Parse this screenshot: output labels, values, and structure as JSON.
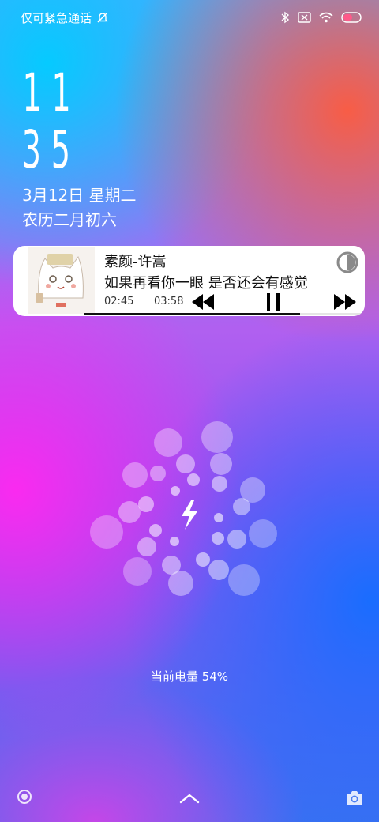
{
  "status_bar": {
    "carrier_text": "仅可紧急通话",
    "icons": [
      "bell-off-icon",
      "bluetooth-icon",
      "no-sim-icon",
      "wifi-icon",
      "battery-icon"
    ]
  },
  "clock": {
    "hours": "11",
    "minutes": "35"
  },
  "date": {
    "solar": "3月12日 星期二",
    "lunar": "农历二月初六"
  },
  "music": {
    "title": "素颜-许嵩",
    "lyric": "如果再看你一眼 是否还会有感觉",
    "current_time": "02:45",
    "total_time": "03:58",
    "progress": 0.77,
    "icons": [
      "album-cover",
      "rewind-icon",
      "pause-icon",
      "fast-forward-icon",
      "theme-contrast-icon"
    ]
  },
  "charging": {
    "icon": "lightning-icon"
  },
  "battery": {
    "label": "当前电量 54%",
    "level_percent": 54
  },
  "bottom_bar": {
    "icons": [
      "voice-assistant-icon",
      "chevron-up-icon",
      "camera-icon"
    ]
  }
}
